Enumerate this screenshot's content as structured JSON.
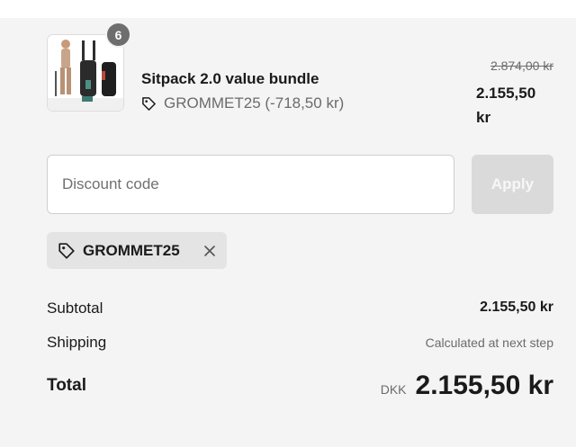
{
  "product": {
    "name": "Sitpack 2.0 value bundle",
    "quantity": "6",
    "discount_text": "GROMMET25 (-718,50 kr)",
    "price_original": "2.874,00 kr",
    "price_current": "2.155,50 kr",
    "image_icon": "product-thumbnail"
  },
  "discount": {
    "placeholder": "Discount code",
    "apply_label": "Apply",
    "applied_code": "GROMMET25"
  },
  "summary": {
    "subtotal_label": "Subtotal",
    "subtotal_value": "2.155,50 kr",
    "shipping_label": "Shipping",
    "shipping_value": "Calculated at next step",
    "total_label": "Total",
    "currency": "DKK",
    "total_value": "2.155,50 kr"
  },
  "colors": {
    "panel_bg": "#f4f4f4",
    "badge_bg": "#6e6e6e",
    "apply_disabled_bg": "#dadada",
    "chip_bg": "#e4e4e4",
    "muted_text": "#6b6b6b"
  }
}
